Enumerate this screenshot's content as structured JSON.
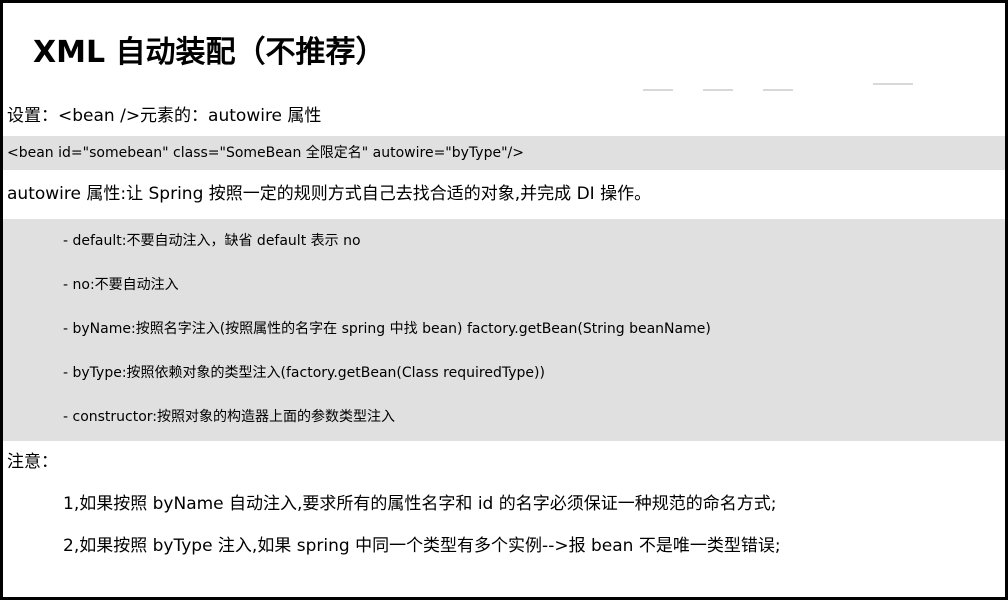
{
  "title": "XML 自动装配（不推荐）",
  "setting_line": "设置：<bean />元素的：autowire 属性",
  "code_line": "<bean id=\"somebean\" class=\"SomeBean 全限定名\" autowire=\"byType\"/>",
  "description": "autowire 属性:让 Spring 按照一定的规则方式自己去找合适的对象,并完成 DI 操作。",
  "options": [
    "- default:不要自动注入，缺省 default 表示 no",
    "- no:不要自动注入",
    "- byName:按照名字注入(按照属性的名字在 spring 中找 bean) factory.getBean(String beanName)",
    "- byType:按照依赖对象的类型注入(factory.getBean(Class requiredType))",
    "- constructor:按照对象的构造器上面的参数类型注入"
  ],
  "note_label": "注意：",
  "notes": [
    "1,如果按照 byName 自动注入,要求所有的属性名字和 id 的名字必须保证一种规范的命名方式;",
    "2,如果按照 byType 注入,如果 spring 中同一个类型有多个实例-->报 bean 不是唯一类型错误;"
  ],
  "colors": {
    "border": "#000000",
    "highlight": "#e0e0e0",
    "background": "#ffffff"
  }
}
